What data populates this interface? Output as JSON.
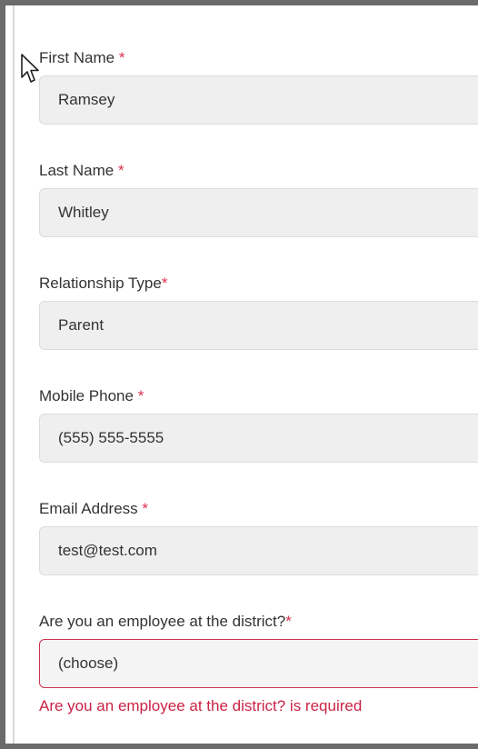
{
  "form": {
    "required_mark": "*",
    "fields": [
      {
        "label": "First Name ",
        "value": "Ramsey"
      },
      {
        "label": "Last Name ",
        "value": "Whitley"
      },
      {
        "label": "Relationship Type",
        "value": "Parent"
      },
      {
        "label": "Mobile Phone ",
        "value": "(555) 555-5555"
      },
      {
        "label": "Email Address ",
        "value": "test@test.com"
      },
      {
        "label": "Are you an employee at the district?",
        "value": "(choose)"
      }
    ],
    "error_message": "Are you an employee at the district? is required"
  },
  "colors": {
    "required": "#d9324e",
    "error": "#cc2244",
    "field_bg": "#efefef",
    "frame": "#6b6b6b"
  },
  "icons": {
    "cursor": "mouse-pointer-icon"
  }
}
